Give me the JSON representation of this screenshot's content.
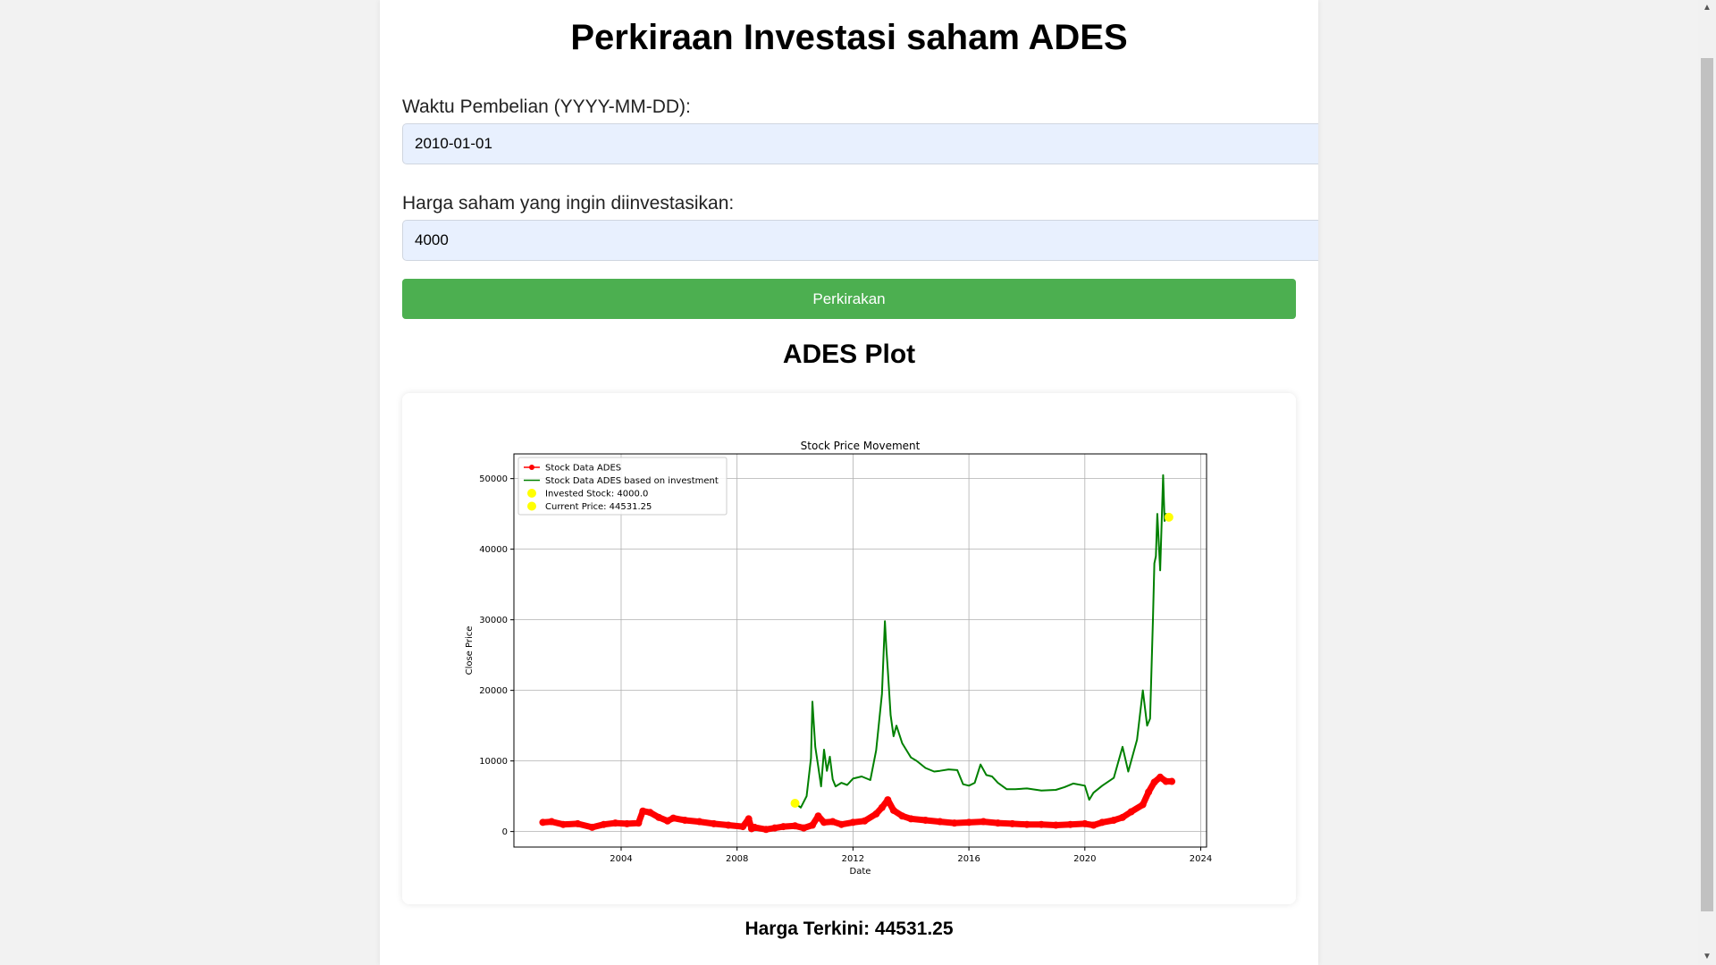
{
  "page": {
    "title": "Perkiraan Investasi saham ADES"
  },
  "form": {
    "date_label": "Waktu Pembelian (YYYY-MM-DD):",
    "date_value": "2010-01-01",
    "amount_label": "Harga saham yang ingin diinvestasikan:",
    "amount_value": "4000",
    "submit_label": "Perkirakan"
  },
  "plot_section": {
    "title": "ADES Plot"
  },
  "result": {
    "text": "Harga Terkini: 44531.25"
  },
  "scrollbar": {
    "up_icon": "▲",
    "down_icon": "▼"
  },
  "chart_data": {
    "type": "line",
    "title": "Stock Price Movement",
    "xlabel": "Date",
    "ylabel": "Close Price",
    "xlim": [
      2000.3,
      2024.2
    ],
    "ylim": [
      -2200,
      53500
    ],
    "x_ticks": [
      2004,
      2008,
      2012,
      2016,
      2020,
      2024
    ],
    "x_tick_labels": [
      "2004",
      "2008",
      "2012",
      "2016",
      "2020",
      "2024"
    ],
    "y_ticks": [
      0,
      10000,
      20000,
      30000,
      40000,
      50000
    ],
    "y_tick_labels": [
      "0",
      "10000",
      "20000",
      "30000",
      "40000",
      "50000"
    ],
    "grid": true,
    "legend_position": "upper-left",
    "colors": {
      "stock": "#ff0000",
      "investment": "#008000",
      "marker": "#ffff00"
    },
    "series": [
      {
        "name": "Stock Data ADES",
        "style": "line-marker",
        "x": [
          2001.3,
          2001.6,
          2002.0,
          2002.5,
          2003.0,
          2003.4,
          2003.8,
          2004.2,
          2004.6,
          2004.75,
          2005.0,
          2005.3,
          2005.6,
          2005.8,
          2006.2,
          2006.7,
          2007.2,
          2007.7,
          2008.2,
          2008.4,
          2008.5,
          2008.6,
          2009.0,
          2009.3,
          2009.6,
          2010.0,
          2010.3,
          2010.6,
          2010.8,
          2011.0,
          2011.3,
          2011.6,
          2012.0,
          2012.4,
          2012.8,
          2013.0,
          2013.2,
          2013.4,
          2013.7,
          2014.0,
          2014.5,
          2015.0,
          2015.5,
          2016.0,
          2016.5,
          2017.0,
          2017.5,
          2018.0,
          2018.5,
          2019.0,
          2019.5,
          2020.0,
          2020.3,
          2020.6,
          2021.0,
          2021.3,
          2021.6,
          2022.0,
          2022.2,
          2022.4,
          2022.6,
          2022.8,
          2023.0
        ],
        "y": [
          1300,
          1400,
          1000,
          1100,
          600,
          1000,
          1200,
          1100,
          1200,
          2900,
          2700,
          2000,
          1500,
          1900,
          1600,
          1400,
          1100,
          900,
          700,
          1800,
          400,
          600,
          300,
          500,
          700,
          800,
          500,
          900,
          2200,
          1300,
          1400,
          1000,
          1300,
          1500,
          2500,
          3400,
          4500,
          3000,
          2200,
          1800,
          1600,
          1400,
          1200,
          1300,
          1400,
          1200,
          1100,
          1000,
          1000,
          900,
          1000,
          1100,
          900,
          1300,
          1600,
          2000,
          2800,
          3800,
          5600,
          7000,
          7700,
          7100,
          7100
        ]
      },
      {
        "name": "Stock Data ADES based on investment",
        "style": "line",
        "x": [
          2010.0,
          2010.2,
          2010.4,
          2010.55,
          2010.6,
          2010.7,
          2010.8,
          2010.9,
          2011.0,
          2011.1,
          2011.2,
          2011.3,
          2011.4,
          2011.6,
          2011.8,
          2012.0,
          2012.3,
          2012.6,
          2012.8,
          2013.0,
          2013.1,
          2013.15,
          2013.2,
          2013.3,
          2013.4,
          2013.5,
          2013.7,
          2014.0,
          2014.2,
          2014.5,
          2014.8,
          2015.0,
          2015.3,
          2015.6,
          2015.8,
          2016.0,
          2016.2,
          2016.4,
          2016.6,
          2016.8,
          2017.0,
          2017.3,
          2017.6,
          2018.0,
          2018.5,
          2019.0,
          2019.3,
          2019.6,
          2020.0,
          2020.15,
          2020.3,
          2020.6,
          2021.0,
          2021.3,
          2021.5,
          2021.8,
          2022.0,
          2022.15,
          2022.25,
          2022.35,
          2022.4,
          2022.45,
          2022.5,
          2022.6,
          2022.7,
          2022.75,
          2022.8,
          2022.9
        ],
        "y": [
          4000,
          3400,
          5000,
          10400,
          18400,
          12000,
          9200,
          6400,
          11600,
          8600,
          10600,
          7400,
          6400,
          6900,
          6600,
          7500,
          7800,
          7300,
          11500,
          19500,
          29800,
          26000,
          23000,
          16500,
          13500,
          15000,
          12500,
          10500,
          10000,
          9000,
          8500,
          8600,
          8800,
          8700,
          6700,
          6500,
          6900,
          9500,
          8000,
          7800,
          6900,
          6000,
          6000,
          6100,
          5800,
          5900,
          6300,
          6800,
          6500,
          4500,
          5500,
          6500,
          7600,
          12000,
          8500,
          13000,
          20000,
          15000,
          16000,
          30000,
          38000,
          39000,
          45000,
          37000,
          50500,
          44000,
          45000,
          44531.25
        ]
      }
    ],
    "points": [
      {
        "name": "Invested Stock: 4000.0",
        "x": 2010.0,
        "y": 4000
      },
      {
        "name": "Current Price: 44531.25",
        "x": 2022.9,
        "y": 44531.25
      }
    ]
  }
}
